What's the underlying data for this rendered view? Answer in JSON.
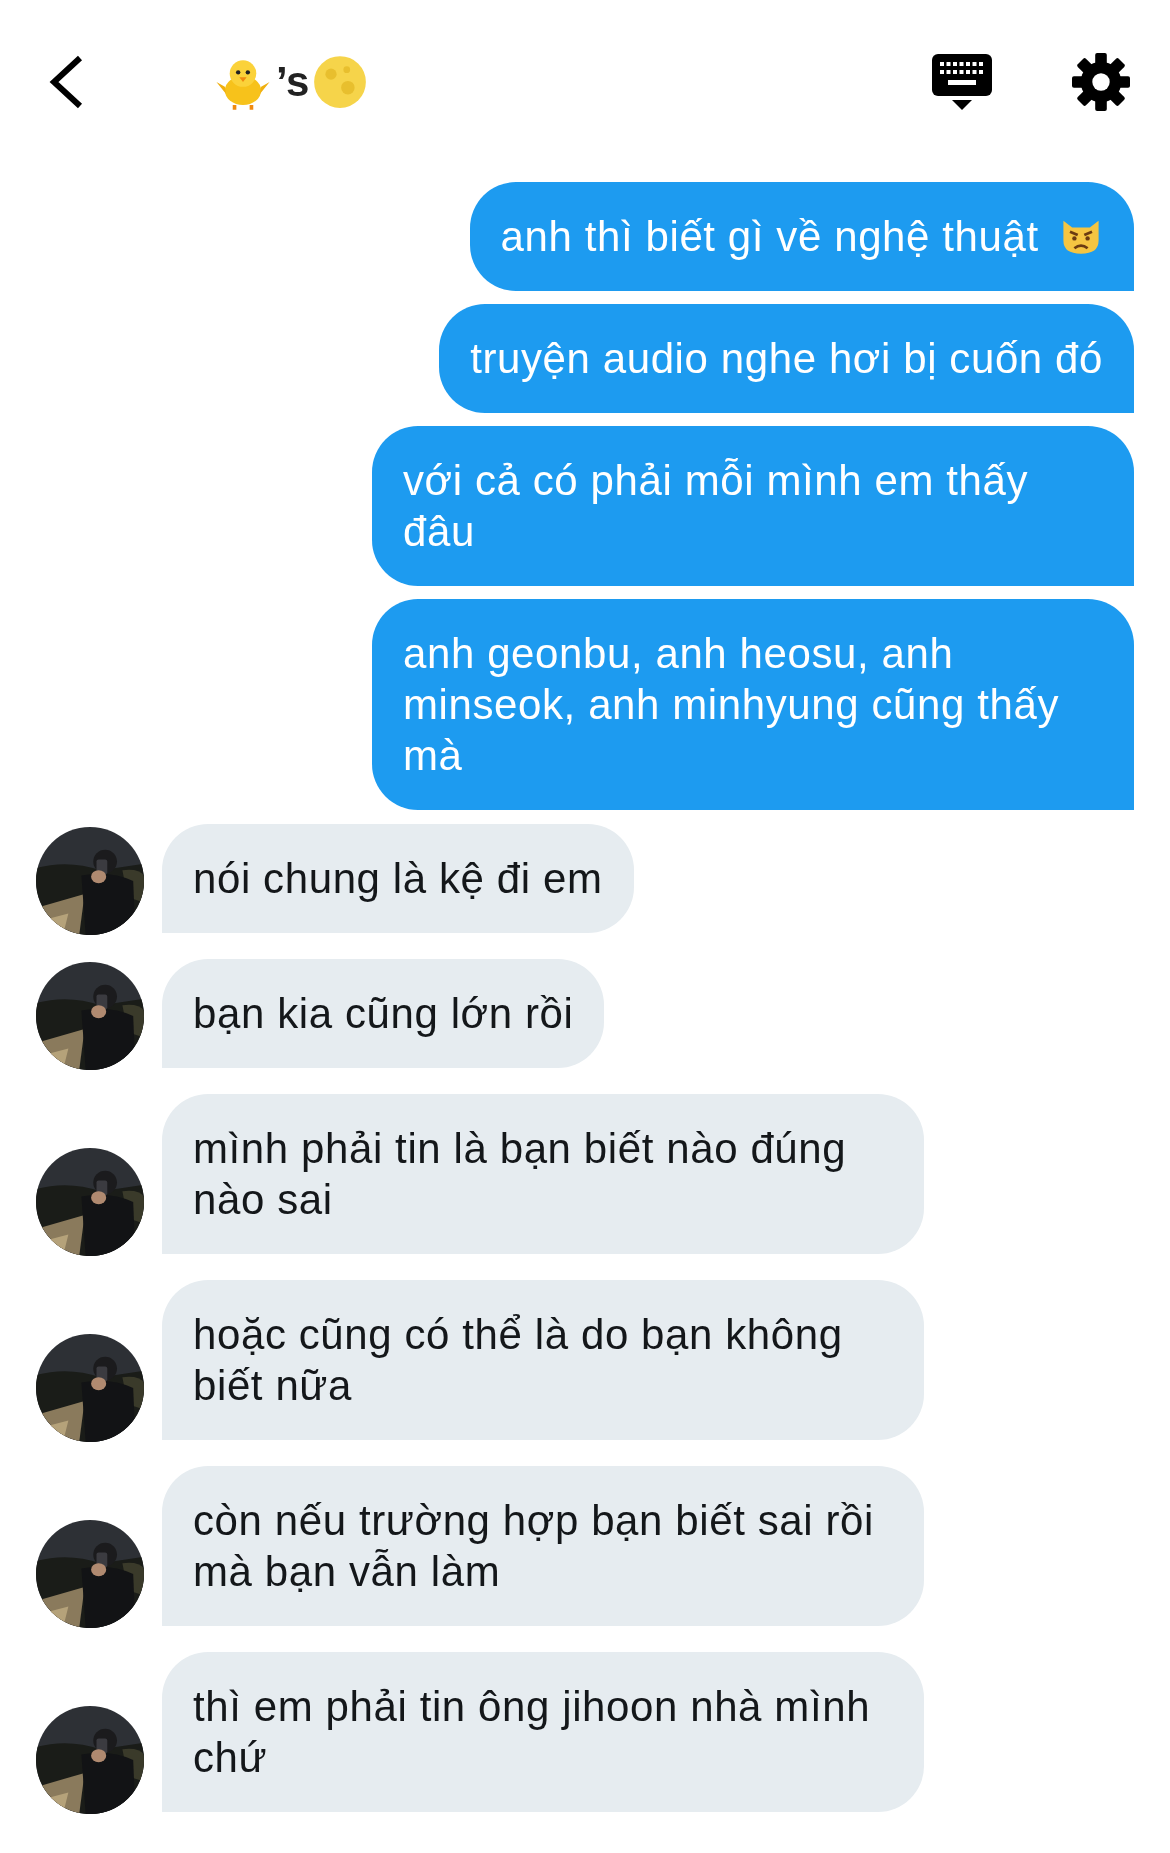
{
  "header": {
    "title": "’s"
  },
  "messages": [
    {
      "kind": "sent",
      "text": "anh thì biết gì về nghệ thuật",
      "emoji": true
    },
    {
      "kind": "sent",
      "text": "truyện audio nghe hơi bị cuốn đó"
    },
    {
      "kind": "sent",
      "text": "với cả có phải mỗi mình em thấy đâu"
    },
    {
      "kind": "sent",
      "text": "anh geonbu, anh heosu, anh minseok, anh minhyung cũng thấy mà"
    },
    {
      "kind": "received",
      "text": "nói chung là kệ đi em"
    },
    {
      "kind": "received",
      "text": "bạn kia cũng lớn rồi"
    },
    {
      "kind": "received",
      "text": "mình phải tin là bạn biết nào đúng nào sai"
    },
    {
      "kind": "received",
      "text": "hoặc cũng có thể là do bạn không biết nữa"
    },
    {
      "kind": "received",
      "text": "còn nếu trường hợp bạn biết sai rồi mà bạn vẫn làm"
    },
    {
      "kind": "received",
      "text": "thì em phải tin ông jihoon nhà mình chứ"
    }
  ]
}
